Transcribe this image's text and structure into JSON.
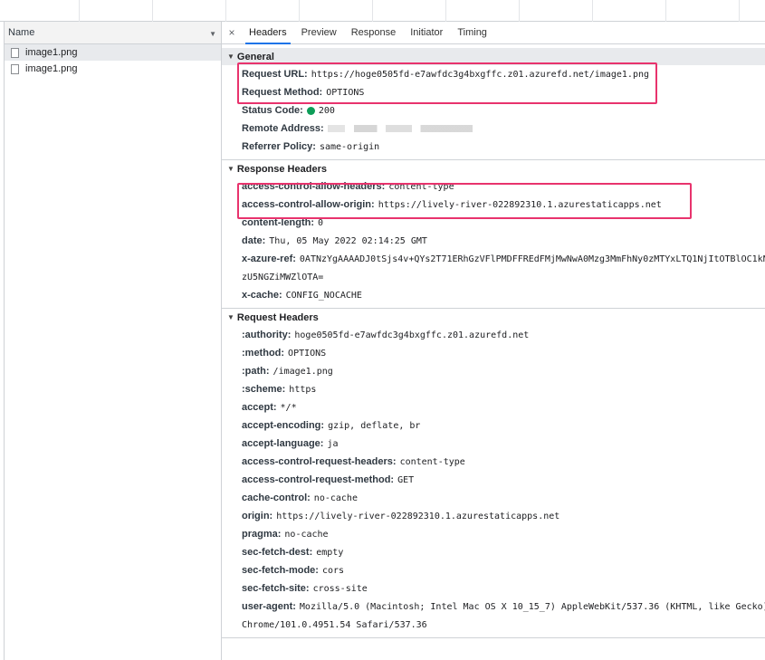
{
  "name_panel": {
    "header_label": "Name",
    "requests": [
      "image1.png",
      "image1.png"
    ]
  },
  "tabs": {
    "close_glyph": "×",
    "items": [
      "Headers",
      "Preview",
      "Response",
      "Initiator",
      "Timing"
    ],
    "active_index": 0
  },
  "general": {
    "title": "General",
    "request_url_key": "Request URL:",
    "request_url": "https://hoge0505fd-e7awfdc3g4bxgffc.z01.azurefd.net/image1.png",
    "request_method_key": "Request Method:",
    "request_method": "OPTIONS",
    "status_code_key": "Status Code:",
    "status_code": "200",
    "status_color": "#0d9d58",
    "remote_address_key": "Remote Address:",
    "referrer_policy_key": "Referrer Policy:",
    "referrer_policy": "same-origin"
  },
  "response_headers": {
    "title": "Response Headers",
    "rows": [
      {
        "k": "access-control-allow-headers:",
        "v": "content-type"
      },
      {
        "k": "access-control-allow-origin:",
        "v": "https://lively-river-022892310.1.azurestaticapps.net"
      },
      {
        "k": "content-length:",
        "v": "0"
      },
      {
        "k": "date:",
        "v": "Thu, 05 May 2022 02:14:25 GMT"
      },
      {
        "k": "x-azure-ref:",
        "v": "0ATNzYgAAAADJ0tSjs4v+QYs2T71ERhGzVFlPMDFFREdFMjMwNwA0Mzg3MmFhNy0zMTYxLTQ1NjItOTBlOC1kN"
      },
      {
        "k": "",
        "v": "zU5NGZiMWZlOTA="
      },
      {
        "k": "x-cache:",
        "v": "CONFIG_NOCACHE"
      }
    ]
  },
  "request_headers": {
    "title": "Request Headers",
    "rows": [
      {
        "k": ":authority:",
        "v": "hoge0505fd-e7awfdc3g4bxgffc.z01.azurefd.net"
      },
      {
        "k": ":method:",
        "v": "OPTIONS"
      },
      {
        "k": ":path:",
        "v": "/image1.png"
      },
      {
        "k": ":scheme:",
        "v": "https"
      },
      {
        "k": "accept:",
        "v": "*/*"
      },
      {
        "k": "accept-encoding:",
        "v": "gzip, deflate, br"
      },
      {
        "k": "accept-language:",
        "v": "ja"
      },
      {
        "k": "access-control-request-headers:",
        "v": "content-type"
      },
      {
        "k": "access-control-request-method:",
        "v": "GET"
      },
      {
        "k": "cache-control:",
        "v": "no-cache"
      },
      {
        "k": "origin:",
        "v": "https://lively-river-022892310.1.azurestaticapps.net"
      },
      {
        "k": "pragma:",
        "v": "no-cache"
      },
      {
        "k": "sec-fetch-dest:",
        "v": "empty"
      },
      {
        "k": "sec-fetch-mode:",
        "v": "cors"
      },
      {
        "k": "sec-fetch-site:",
        "v": "cross-site"
      },
      {
        "k": "user-agent:",
        "v": "Mozilla/5.0 (Macintosh; Intel Mac OS X 10_15_7) AppleWebKit/537.36 (KHTML, like Gecko)"
      },
      {
        "k": "",
        "v": "Chrome/101.0.4951.54 Safari/537.36"
      }
    ]
  },
  "highlight_color": "#e8336d"
}
